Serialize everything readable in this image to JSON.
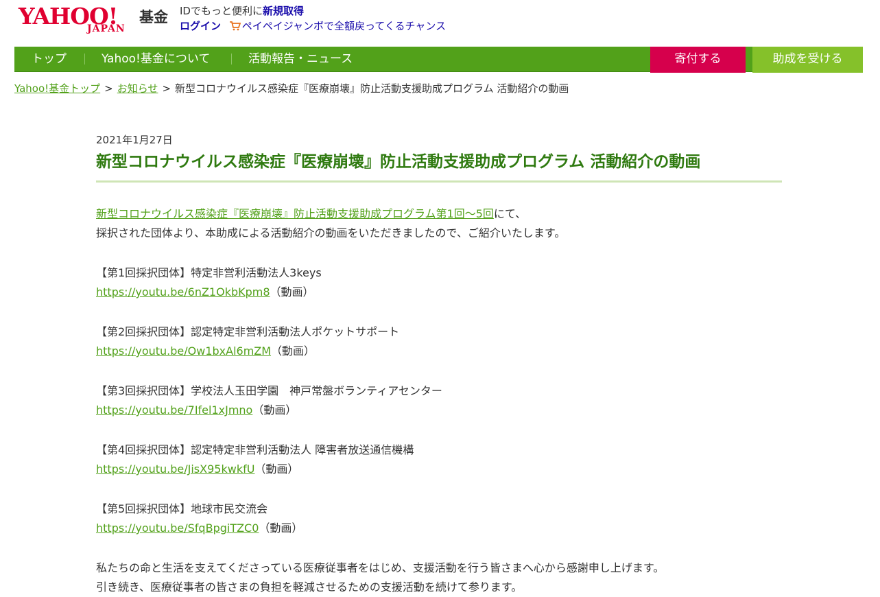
{
  "header": {
    "logo_text": "YAHOO!",
    "logo_sub": "JAPAN",
    "logo_kikin": "基金",
    "promo_prefix": "IDでもっと便利に",
    "promo_signup": "新規取得",
    "login": "ログイン",
    "paypay_text": "ペイペイジャンボで全額戻ってくるチャンス",
    "cart_icon": "shopping-cart-icon"
  },
  "nav": {
    "items": [
      "トップ",
      "Yahoo!基金について",
      "活動報告・ニュース"
    ],
    "donate": "寄付する",
    "grant": "助成を受ける",
    "colors": {
      "bar": "#52a11a",
      "donate": "#d6004c",
      "grant": "#85c12a"
    }
  },
  "breadcrumb": {
    "home": "Yahoo!基金トップ",
    "news": "お知らせ",
    "sep": ">",
    "current": "新型コロナウイルス感染症『医療崩壊』防止活動支援助成プログラム 活動紹介の動画"
  },
  "article": {
    "date": "2021年1月27日",
    "title": "新型コロナウイルス感染症『医療崩壊』防止活動支援助成プログラム 活動紹介の動画",
    "intro_link": "新型コロナウイルス感染症『医療崩壊』防止活動支援助成プログラム第1回～5回",
    "intro_suffix": "にて、",
    "intro_line2": "採択された団体より、本助成による活動紹介の動画をいただきましたので、ご紹介いたします。",
    "groups": [
      {
        "label": "【第1回採択団体】特定非営利活動法人3keys",
        "url": "https://youtu.be/6nZ1OkbKpm8",
        "suffix": "（動画）"
      },
      {
        "label": "【第2回採択団体】認定特定非営利活動法人ポケットサポート",
        "url": "https://youtu.be/Ow1bxAl6mZM",
        "suffix": "（動画）"
      },
      {
        "label": "【第3回採択団体】学校法人玉田学園　神戸常盤ボランティアセンター",
        "url": "https://youtu.be/7Ifel1xJmno",
        "suffix": "（動画）"
      },
      {
        "label": "【第4回採択団体】認定特定非営利活動法人 障害者放送通信機構",
        "url": "https://youtu.be/JisX95kwkfU",
        "suffix": "（動画）"
      },
      {
        "label": "【第5回採択団体】地球市民交流会",
        "url": "https://youtu.be/SfqBpgiTZC0",
        "suffix": "（動画）"
      }
    ],
    "closing": [
      "私たちの命と生活を支えてくださっている医療従事者をはじめ、支援活動を行う皆さまへ心から感謝申し上げます。",
      "引き続き、医療従事者の皆さまの負担を軽減させるための支援活動を続けて参ります。"
    ]
  }
}
